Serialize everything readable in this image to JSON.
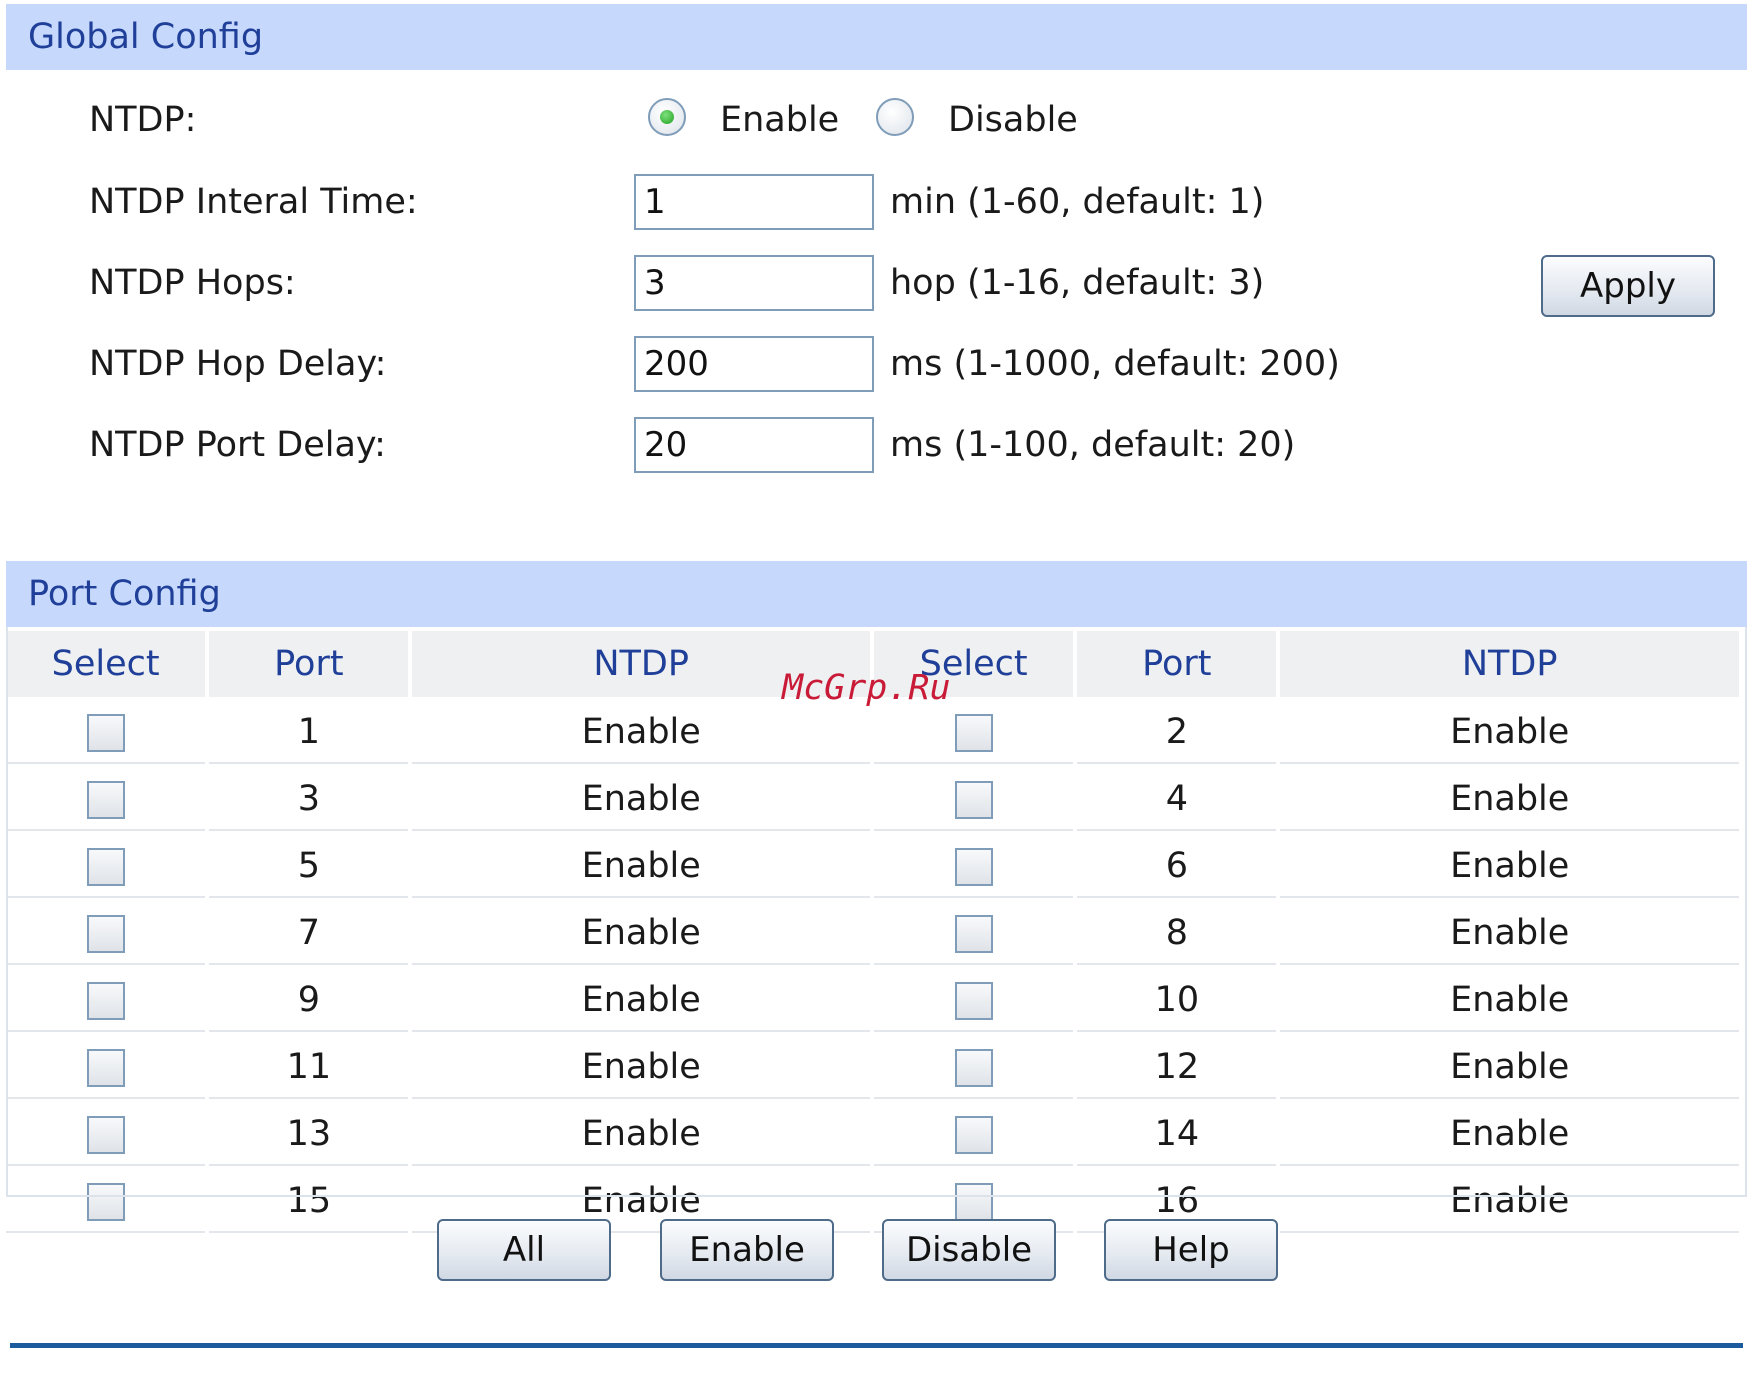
{
  "global": {
    "title": "Global Config",
    "ntdp_label": "NTDP:",
    "enable_label": "Enable",
    "disable_label": "Disable",
    "selected": "Enable",
    "interval_label": "NTDP Interal Time:",
    "interval_value": "1",
    "interval_hint": "min (1-60, default: 1)",
    "hops_label": "NTDP Hops:",
    "hops_value": "3",
    "hops_hint": "hop (1-16, default: 3)",
    "hop_delay_label": "NTDP Hop Delay:",
    "hop_delay_value": "200",
    "hop_delay_hint": "ms (1-1000, default: 200)",
    "port_delay_label": "NTDP Port Delay:",
    "port_delay_value": "20",
    "port_delay_hint": "ms (1-100, default: 20)",
    "apply_label": "Apply"
  },
  "port_config": {
    "title": "Port Config",
    "headers": [
      "Select",
      "Port",
      "NTDP",
      "Select",
      "Port",
      "NTDP"
    ],
    "rows": [
      {
        "left_port": "1",
        "left_ntdp": "Enable",
        "right_port": "2",
        "right_ntdp": "Enable"
      },
      {
        "left_port": "3",
        "left_ntdp": "Enable",
        "right_port": "4",
        "right_ntdp": "Enable"
      },
      {
        "left_port": "5",
        "left_ntdp": "Enable",
        "right_port": "6",
        "right_ntdp": "Enable"
      },
      {
        "left_port": "7",
        "left_ntdp": "Enable",
        "right_port": "8",
        "right_ntdp": "Enable"
      },
      {
        "left_port": "9",
        "left_ntdp": "Enable",
        "right_port": "10",
        "right_ntdp": "Enable"
      },
      {
        "left_port": "11",
        "left_ntdp": "Enable",
        "right_port": "12",
        "right_ntdp": "Enable"
      },
      {
        "left_port": "13",
        "left_ntdp": "Enable",
        "right_port": "14",
        "right_ntdp": "Enable"
      },
      {
        "left_port": "15",
        "left_ntdp": "Enable",
        "right_port": "16",
        "right_ntdp": "Enable"
      }
    ]
  },
  "buttons": {
    "all": "All",
    "enable": "Enable",
    "disable": "Disable",
    "help": "Help"
  },
  "watermark": "McGrp.Ru",
  "colors": {
    "section_bar": "#c6d9fc",
    "section_text": "#1f3f99",
    "bottom_rule": "#1c5b9e",
    "watermark": "#c8102e"
  }
}
